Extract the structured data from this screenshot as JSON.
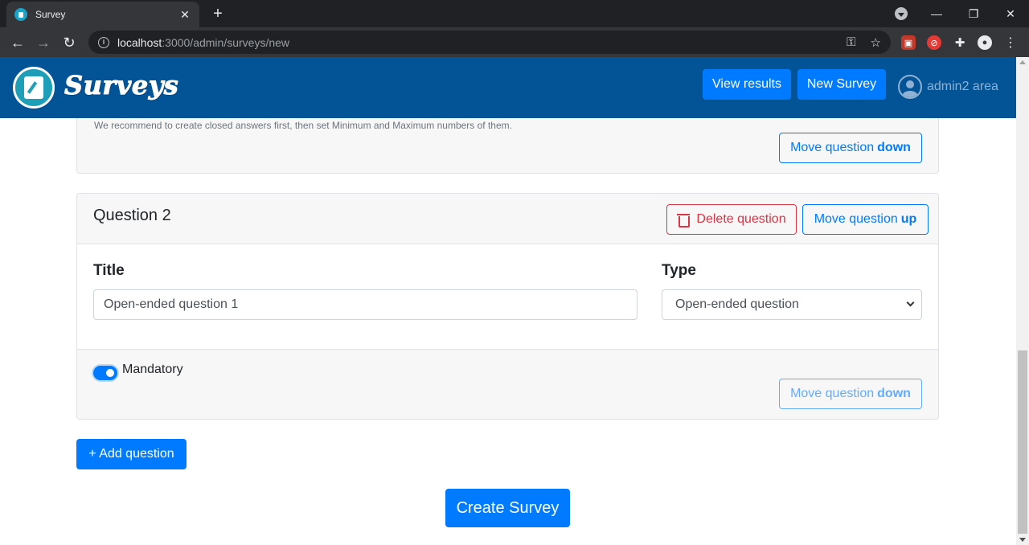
{
  "browser": {
    "tab_title": "Survey",
    "url_host": "localhost",
    "url_rest": ":3000/admin/surveys/new"
  },
  "header": {
    "logo_text": "Surveys",
    "view_results": "View results",
    "new_survey": "New Survey",
    "user_area": "admin2 area"
  },
  "question1": {
    "hint": "We recommend to create closed answers first, then set Minimum and Maximum numbers of them.",
    "move_down_prefix": "Move question",
    "move_down_word": "down"
  },
  "question2": {
    "heading": "Question 2",
    "delete_label": "Delete question",
    "move_up_prefix": "Move question",
    "move_up_word": "up",
    "title_label": "Title",
    "title_value": "Open-ended question 1",
    "type_label": "Type",
    "type_value": "Open-ended question",
    "mandatory_label": "Mandatory",
    "mandatory_on": true,
    "move_down_prefix": "Move question",
    "move_down_word": "down"
  },
  "actions": {
    "add_question": "+ Add question",
    "create_survey": "Create Survey"
  },
  "colors": {
    "header_bg": "#025497",
    "primary": "#007bff",
    "danger": "#dc3545"
  }
}
